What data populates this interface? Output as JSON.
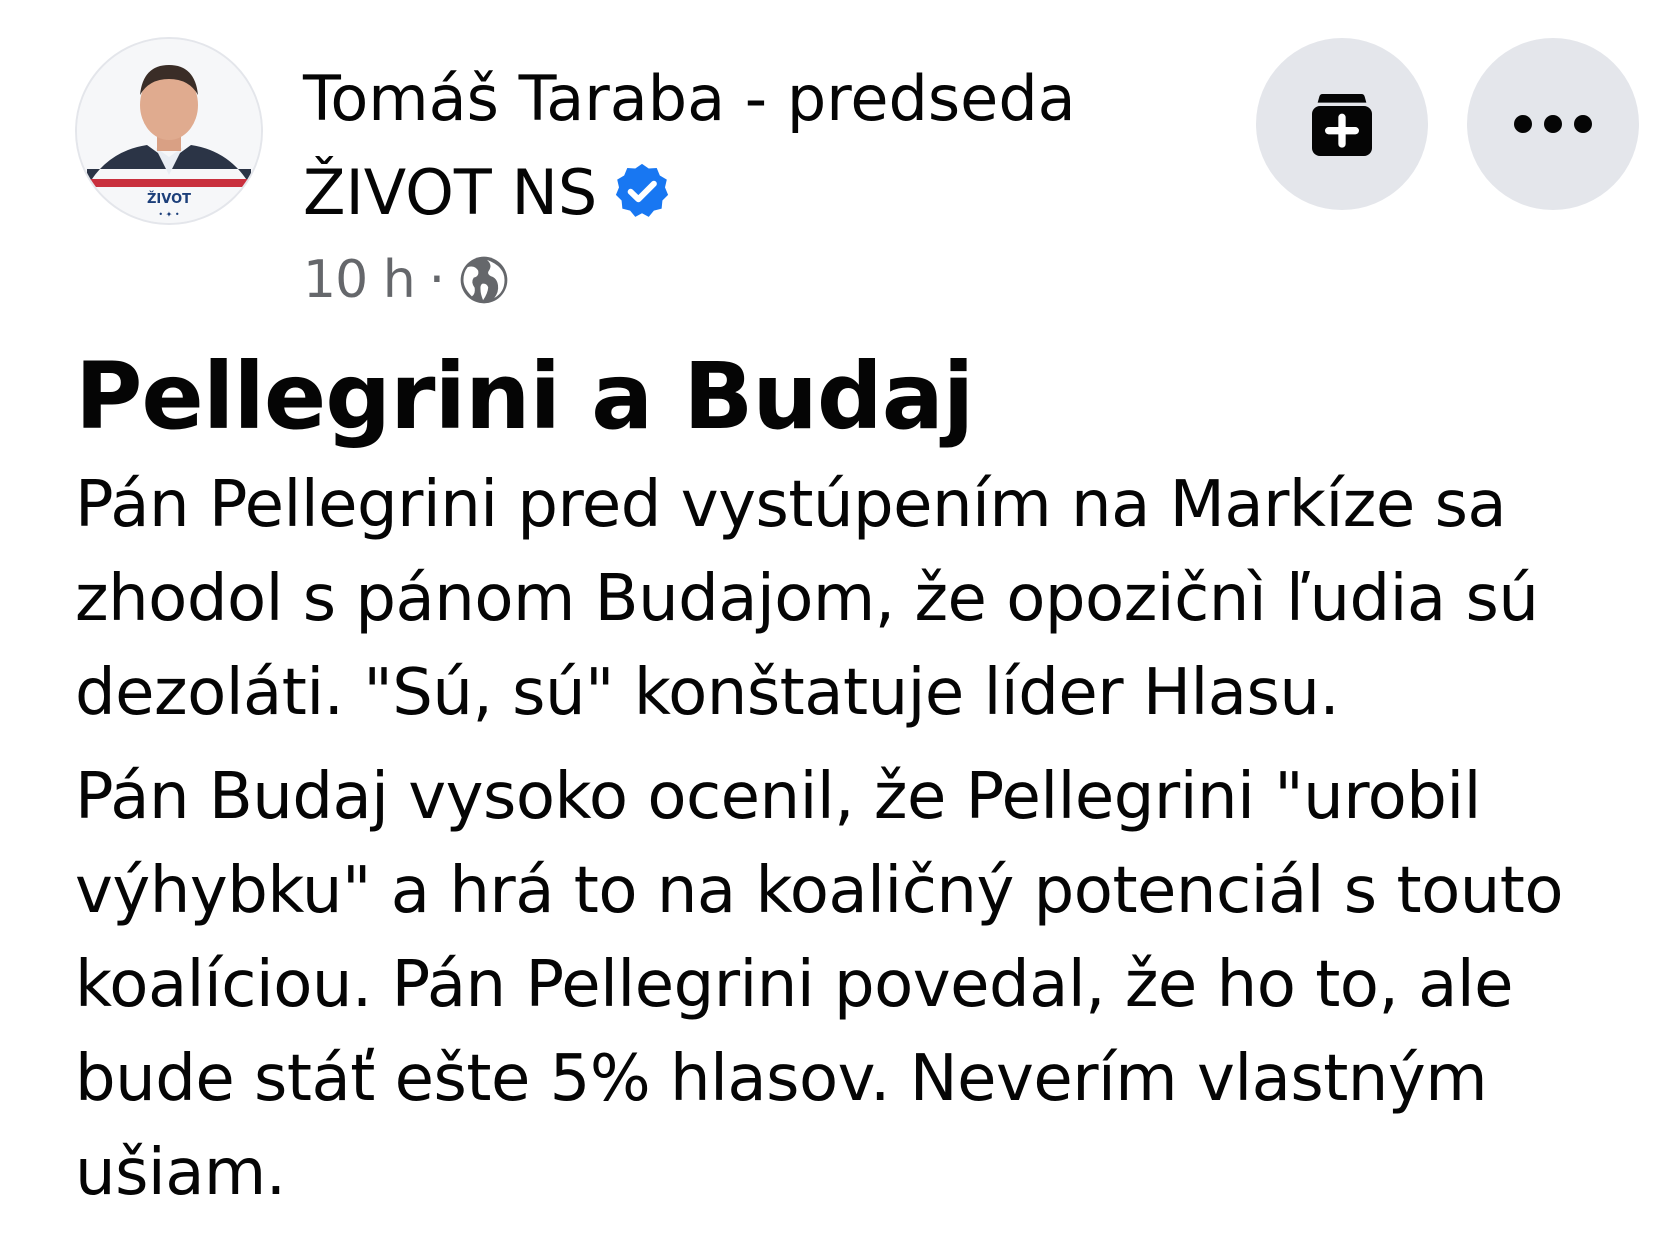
{
  "post": {
    "author_line1": "Tomáš Taraba - predseda",
    "author_line2": "ŽIVOT NS",
    "time": "10 h",
    "separator": "·",
    "title": "Pellegrini a Budaj",
    "paragraph1": "Pán Pellegrini pred vystúpením na Markíze sa zhodol s pánom Budajom, že opozičnì ľudia sú dezoláti. \"Sú, sú\" konštatuje líder Hlasu.",
    "paragraph2": "Pán Budaj vysoko ocenil, že Pellegrini \"urobil výhybku\" a hrá to na koaličný potenciál s touto koalíciou. Pán Pellegrini povedal, že ho to, ale bude stáť ešte 5% hlasov. Neverím vlastným ušiam."
  },
  "icons": {
    "verified": "verified-badge-icon",
    "audience": "globe-icon",
    "archive": "archive-add-icon",
    "more": "more-dots-icon"
  },
  "colors": {
    "verified_blue": "#1877f2",
    "meta_gray": "#65676b",
    "button_bg": "#e4e6eb",
    "text": "#050505"
  }
}
